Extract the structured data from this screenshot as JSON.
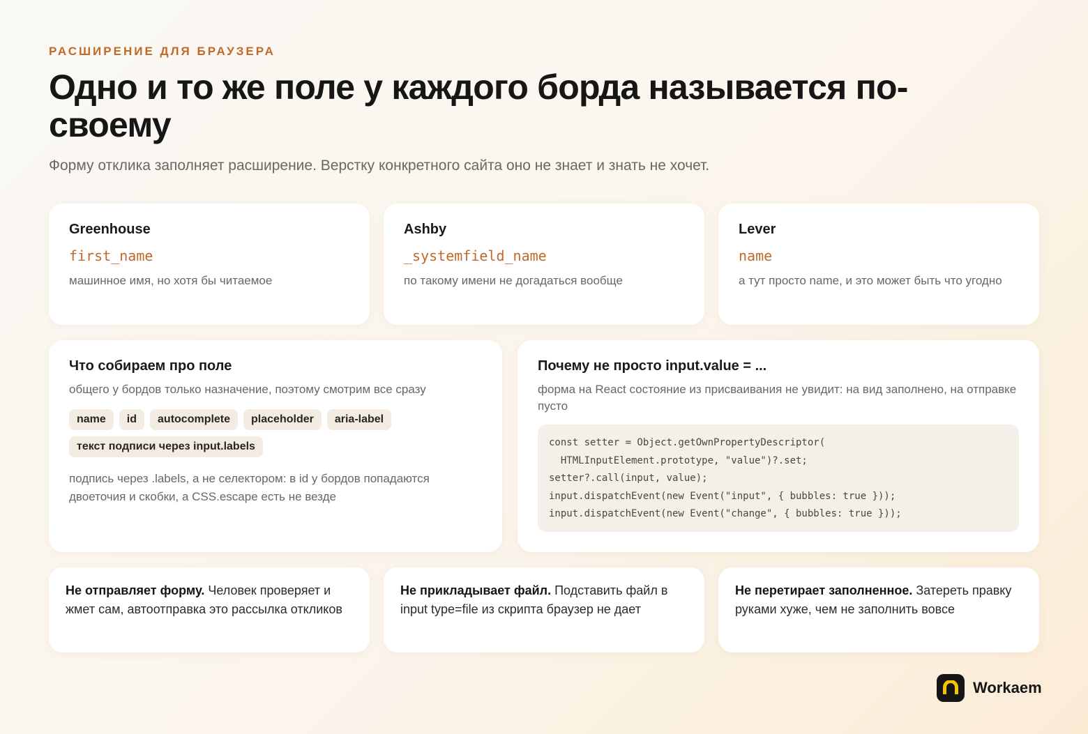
{
  "header": {
    "eyebrow": "РАСШИРЕНИЕ ДЛЯ БРАУЗЕРА",
    "title": "Одно и то же поле у каждого борда называется по-своему",
    "subtitle": "Форму отклика заполняет расширение. Верстку конкретного сайта оно не знает и знать не хочет."
  },
  "boards": [
    {
      "name": "Greenhouse",
      "field": "first_name",
      "note": "машинное имя, но хотя бы читаемое"
    },
    {
      "name": "Ashby",
      "field": "_systemfield_name",
      "note": "по такому имени не догадаться вообще"
    },
    {
      "name": "Lever",
      "field": "name",
      "note": "а тут просто name, и это может быть что угодно"
    }
  ],
  "collect": {
    "title": "Что собираем про поле",
    "subtitle": "общего у бордов только назначение, поэтому смотрим все сразу",
    "chips": [
      "name",
      "id",
      "autocomplete",
      "placeholder",
      "aria-label",
      "текст подписи через input.labels"
    ],
    "note": "подпись через .labels, а не селектором: в id у бордов попадаются двоеточия и скобки, а CSS.escape есть не везде"
  },
  "why": {
    "title": "Почему не просто input.value = ...",
    "subtitle": "форма на React состояние из присваивания не увидит: на вид заполнено, на отправке пусто",
    "code": [
      "const setter = Object.getOwnPropertyDescriptor(",
      "  HTMLInputElement.prototype, \"value\")?.set;",
      "setter?.call(input, value);",
      "input.dispatchEvent(new Event(\"input\", { bubbles: true }));",
      "input.dispatchEvent(new Event(\"change\", { bubbles: true }));"
    ]
  },
  "notes": [
    {
      "bold": "Не отправляет форму.",
      "text": " Человек проверяет и жмет сам, автоотправка это рассылка откликов"
    },
    {
      "bold": "Не прикладывает файл.",
      "text": " Подставить файл в input type=file из скрипта браузер не дает"
    },
    {
      "bold": "Не перетирает заполненное.",
      "text": " Затереть правку руками хуже, чем не заполнить вовсе"
    }
  ],
  "brand": {
    "name": "Workaem",
    "logo_icon": "arch-icon",
    "accent": "#f5c400"
  },
  "colors": {
    "accent": "#c0692a",
    "text": "#161616",
    "muted": "#6b6660",
    "chip_bg": "#f2ece2",
    "code_bg": "#f4f0e9"
  }
}
